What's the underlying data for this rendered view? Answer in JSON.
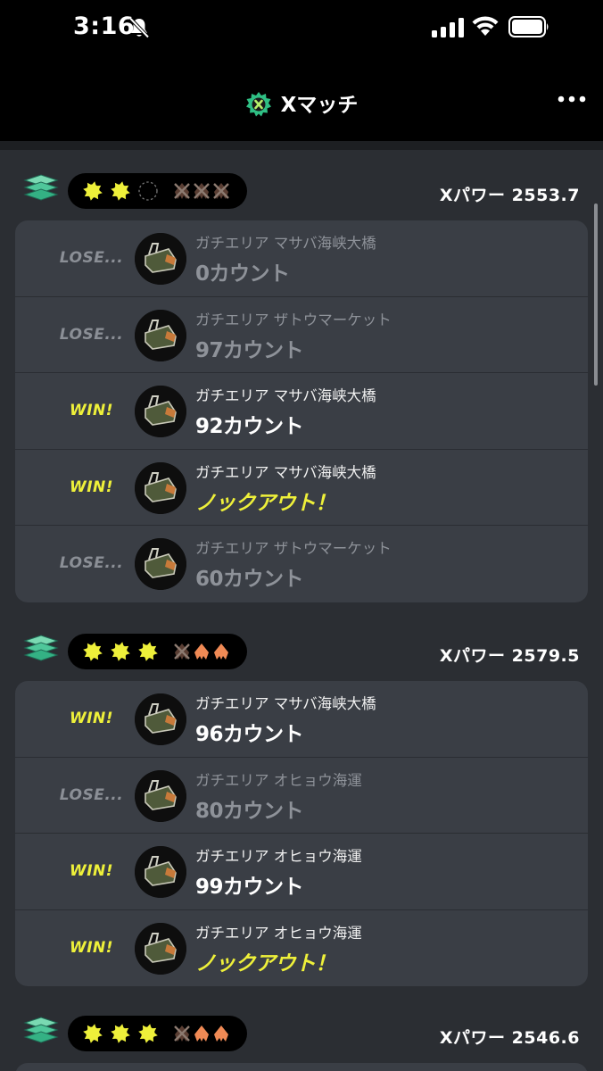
{
  "status_bar": {
    "time": "3:16"
  },
  "nav": {
    "title": "Xマッチ"
  },
  "sets": [
    {
      "x_power": "Xパワー 2553.7",
      "progress": {
        "wins": 2,
        "win_slots": 3,
        "losses": 3,
        "loss_slots": 3
      },
      "battles": [
        {
          "result": "LOSE...",
          "outcome": "lose",
          "stage": "ガチエリア マサバ海峡大橋",
          "score": "0カウント"
        },
        {
          "result": "LOSE...",
          "outcome": "lose",
          "stage": "ガチエリア ザトウマーケット",
          "score": "97カウント"
        },
        {
          "result": "WIN!",
          "outcome": "win",
          "stage": "ガチエリア マサバ海峡大橋",
          "score": "92カウント"
        },
        {
          "result": "WIN!",
          "outcome": "win",
          "stage": "ガチエリア マサバ海峡大橋",
          "score": "ノックアウト！",
          "knockout": true
        },
        {
          "result": "LOSE...",
          "outcome": "lose",
          "stage": "ガチエリア ザトウマーケット",
          "score": "60カウント"
        }
      ]
    },
    {
      "x_power": "Xパワー 2579.5",
      "progress": {
        "wins": 3,
        "win_slots": 3,
        "losses": 1,
        "loss_slots": 3
      },
      "battles": [
        {
          "result": "WIN!",
          "outcome": "win",
          "stage": "ガチエリア マサバ海峡大橋",
          "score": "96カウント"
        },
        {
          "result": "LOSE...",
          "outcome": "lose",
          "stage": "ガチエリア オヒョウ海運",
          "score": "80カウント"
        },
        {
          "result": "WIN!",
          "outcome": "win",
          "stage": "ガチエリア オヒョウ海運",
          "score": "99カウント"
        },
        {
          "result": "WIN!",
          "outcome": "win",
          "stage": "ガチエリア オヒョウ海運",
          "score": "ノックアウト！",
          "knockout": true
        }
      ]
    },
    {
      "x_power": "Xパワー 2546.6",
      "progress": {
        "wins": 3,
        "win_slots": 3,
        "losses": 1,
        "loss_slots": 3
      },
      "battles": []
    }
  ]
}
